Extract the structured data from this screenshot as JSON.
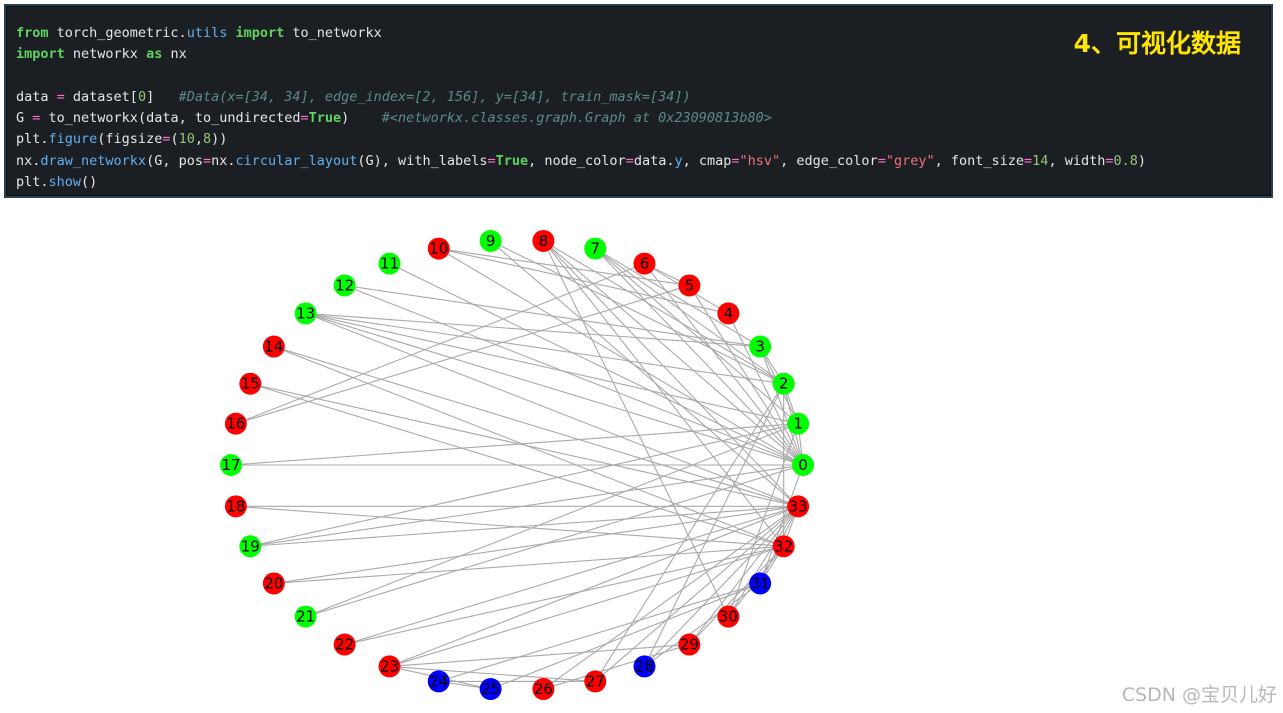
{
  "code_panel": {
    "title": "4、可视化数据",
    "lines": [
      [
        {
          "t": "from",
          "c": "kw"
        },
        {
          "t": " torch_geometric.",
          "c": "txt"
        },
        {
          "t": "utils",
          "c": "fn"
        },
        {
          "t": " ",
          "c": "txt"
        },
        {
          "t": "import",
          "c": "kw"
        },
        {
          "t": " to_networkx",
          "c": "txt"
        }
      ],
      [
        {
          "t": "import",
          "c": "kw"
        },
        {
          "t": " networkx ",
          "c": "txt"
        },
        {
          "t": "as",
          "c": "kw"
        },
        {
          "t": " nx",
          "c": "txt"
        }
      ],
      [],
      [
        {
          "t": "data ",
          "c": "txt"
        },
        {
          "t": "=",
          "c": "op"
        },
        {
          "t": " dataset[",
          "c": "txt"
        },
        {
          "t": "0",
          "c": "num"
        },
        {
          "t": "]   ",
          "c": "txt"
        },
        {
          "t": "#Data(x=[34, 34], edge_index=[2, 156], y=[34], train_mask=[34])",
          "c": "cm"
        }
      ],
      [
        {
          "t": "G ",
          "c": "txt"
        },
        {
          "t": "=",
          "c": "op"
        },
        {
          "t": " to_networkx(data, to_undirected",
          "c": "txt"
        },
        {
          "t": "=",
          "c": "op"
        },
        {
          "t": "True",
          "c": "kw"
        },
        {
          "t": ")    ",
          "c": "txt"
        },
        {
          "t": "#<networkx.classes.graph.Graph at 0x23090813b80>",
          "c": "cm"
        }
      ],
      [
        {
          "t": "plt.",
          "c": "txt"
        },
        {
          "t": "figure",
          "c": "fn"
        },
        {
          "t": "(figsize",
          "c": "txt"
        },
        {
          "t": "=",
          "c": "op"
        },
        {
          "t": "(",
          "c": "txt"
        },
        {
          "t": "10",
          "c": "num"
        },
        {
          "t": ",",
          "c": "txt"
        },
        {
          "t": "8",
          "c": "num"
        },
        {
          "t": "))",
          "c": "txt"
        }
      ],
      [
        {
          "t": "nx.",
          "c": "txt"
        },
        {
          "t": "draw_networkx",
          "c": "fn"
        },
        {
          "t": "(G, pos",
          "c": "txt"
        },
        {
          "t": "=",
          "c": "op"
        },
        {
          "t": "nx.",
          "c": "txt"
        },
        {
          "t": "circular_layout",
          "c": "fn"
        },
        {
          "t": "(G), with_labels",
          "c": "txt"
        },
        {
          "t": "=",
          "c": "op"
        },
        {
          "t": "True",
          "c": "kw"
        },
        {
          "t": ", node_color",
          "c": "txt"
        },
        {
          "t": "=",
          "c": "op"
        },
        {
          "t": "data.",
          "c": "txt"
        },
        {
          "t": "y",
          "c": "fn"
        },
        {
          "t": ", cmap",
          "c": "txt"
        },
        {
          "t": "=",
          "c": "op"
        },
        {
          "t": "\"hsv\"",
          "c": "str"
        },
        {
          "t": ", edge_color",
          "c": "txt"
        },
        {
          "t": "=",
          "c": "op"
        },
        {
          "t": "\"grey\"",
          "c": "str"
        },
        {
          "t": ", font_size",
          "c": "txt"
        },
        {
          "t": "=",
          "c": "op"
        },
        {
          "t": "14",
          "c": "num"
        },
        {
          "t": ", width",
          "c": "txt"
        },
        {
          "t": "=",
          "c": "op"
        },
        {
          "t": "0.8",
          "c": "num"
        },
        {
          "t": ")",
          "c": "txt"
        }
      ],
      [
        {
          "t": "plt.",
          "c": "txt"
        },
        {
          "t": "show",
          "c": "fn"
        },
        {
          "t": "()",
          "c": "txt"
        }
      ]
    ]
  },
  "graph": {
    "colors": {
      "red": "#ff0000",
      "green": "#00ff00",
      "blue": "#0000ff",
      "edge": "#a9a9a9"
    },
    "nodes": [
      {
        "id": "0",
        "color": "green"
      },
      {
        "id": "1",
        "color": "green"
      },
      {
        "id": "2",
        "color": "green"
      },
      {
        "id": "3",
        "color": "green"
      },
      {
        "id": "4",
        "color": "red"
      },
      {
        "id": "5",
        "color": "red"
      },
      {
        "id": "6",
        "color": "red"
      },
      {
        "id": "7",
        "color": "green"
      },
      {
        "id": "8",
        "color": "red"
      },
      {
        "id": "9",
        "color": "green"
      },
      {
        "id": "10",
        "color": "red"
      },
      {
        "id": "11",
        "color": "green"
      },
      {
        "id": "12",
        "color": "green"
      },
      {
        "id": "13",
        "color": "green"
      },
      {
        "id": "14",
        "color": "red"
      },
      {
        "id": "15",
        "color": "red"
      },
      {
        "id": "16",
        "color": "red"
      },
      {
        "id": "17",
        "color": "green"
      },
      {
        "id": "18",
        "color": "red"
      },
      {
        "id": "19",
        "color": "green"
      },
      {
        "id": "20",
        "color": "red"
      },
      {
        "id": "21",
        "color": "green"
      },
      {
        "id": "22",
        "color": "red"
      },
      {
        "id": "23",
        "color": "red"
      },
      {
        "id": "24",
        "color": "blue"
      },
      {
        "id": "25",
        "color": "blue"
      },
      {
        "id": "26",
        "color": "red"
      },
      {
        "id": "27",
        "color": "red"
      },
      {
        "id": "28",
        "color": "blue"
      },
      {
        "id": "29",
        "color": "red"
      },
      {
        "id": "30",
        "color": "red"
      },
      {
        "id": "31",
        "color": "blue"
      },
      {
        "id": "32",
        "color": "red"
      },
      {
        "id": "33",
        "color": "red"
      }
    ],
    "edges": [
      [
        0,
        1
      ],
      [
        0,
        2
      ],
      [
        0,
        3
      ],
      [
        0,
        4
      ],
      [
        0,
        5
      ],
      [
        0,
        6
      ],
      [
        0,
        7
      ],
      [
        0,
        8
      ],
      [
        0,
        10
      ],
      [
        0,
        11
      ],
      [
        0,
        12
      ],
      [
        0,
        13
      ],
      [
        0,
        17
      ],
      [
        0,
        19
      ],
      [
        0,
        21
      ],
      [
        0,
        31
      ],
      [
        1,
        2
      ],
      [
        1,
        3
      ],
      [
        1,
        7
      ],
      [
        1,
        13
      ],
      [
        1,
        17
      ],
      [
        1,
        19
      ],
      [
        1,
        21
      ],
      [
        1,
        30
      ],
      [
        2,
        3
      ],
      [
        2,
        7
      ],
      [
        2,
        8
      ],
      [
        2,
        9
      ],
      [
        2,
        13
      ],
      [
        2,
        27
      ],
      [
        2,
        28
      ],
      [
        2,
        32
      ],
      [
        3,
        7
      ],
      [
        3,
        12
      ],
      [
        3,
        13
      ],
      [
        4,
        6
      ],
      [
        4,
        10
      ],
      [
        5,
        6
      ],
      [
        5,
        10
      ],
      [
        5,
        16
      ],
      [
        6,
        16
      ],
      [
        8,
        30
      ],
      [
        8,
        32
      ],
      [
        8,
        33
      ],
      [
        9,
        33
      ],
      [
        13,
        33
      ],
      [
        14,
        32
      ],
      [
        14,
        33
      ],
      [
        15,
        32
      ],
      [
        15,
        33
      ],
      [
        18,
        32
      ],
      [
        18,
        33
      ],
      [
        19,
        33
      ],
      [
        20,
        32
      ],
      [
        20,
        33
      ],
      [
        22,
        32
      ],
      [
        22,
        33
      ],
      [
        23,
        25
      ],
      [
        23,
        27
      ],
      [
        23,
        29
      ],
      [
        23,
        32
      ],
      [
        23,
        33
      ],
      [
        24,
        25
      ],
      [
        24,
        27
      ],
      [
        24,
        31
      ],
      [
        25,
        31
      ],
      [
        26,
        29
      ],
      [
        26,
        33
      ],
      [
        27,
        33
      ],
      [
        28,
        31
      ],
      [
        28,
        33
      ],
      [
        29,
        32
      ],
      [
        29,
        33
      ],
      [
        30,
        32
      ],
      [
        30,
        33
      ],
      [
        31,
        32
      ],
      [
        31,
        33
      ],
      [
        32,
        33
      ]
    ]
  },
  "watermark": "CSDN @宝贝儿好"
}
